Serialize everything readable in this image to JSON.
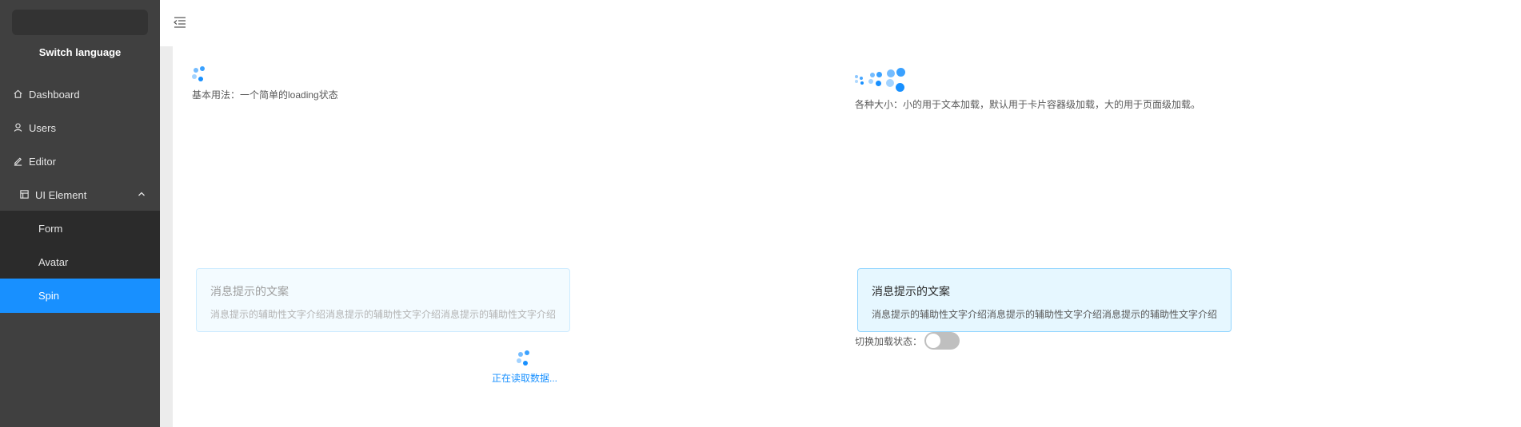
{
  "sidebar": {
    "switch_language": "Switch language",
    "items": [
      {
        "label": "Dashboard",
        "icon": "home-icon"
      },
      {
        "label": "Users",
        "icon": "user-icon"
      },
      {
        "label": "Editor",
        "icon": "edit-icon"
      },
      {
        "label": "UI Element",
        "icon": "layout-icon",
        "expanded": true
      }
    ],
    "subitems": [
      {
        "label": "Form"
      },
      {
        "label": "Avatar"
      },
      {
        "label": "Spin",
        "active": true
      }
    ]
  },
  "topbar": {
    "fold_icon": "menu-fold-icon"
  },
  "demos": {
    "basic_caption": "基本用法：一个简单的loading状态",
    "sizes_caption": "各种大小：小的用于文本加载，默认用于卡片容器级加载，大的用于页面级加载。",
    "alert_left": {
      "title": "消息提示的文案",
      "desc": "消息提示的辅助性文字介绍消息提示的辅助性文字介绍消息提示的辅助性文字介绍"
    },
    "alert_right": {
      "title": "消息提示的文案",
      "desc": "消息提示的辅助性文字介绍消息提示的辅助性文字介绍消息提示的辅助性文字介绍"
    },
    "loading_tip": "正在读取数据...",
    "toggle_label": "切换加载状态：",
    "toggle_on": false
  },
  "colors": {
    "primary": "#1890ff",
    "sidebar_bg": "#404040",
    "submenu_bg": "#2b2b2b"
  }
}
